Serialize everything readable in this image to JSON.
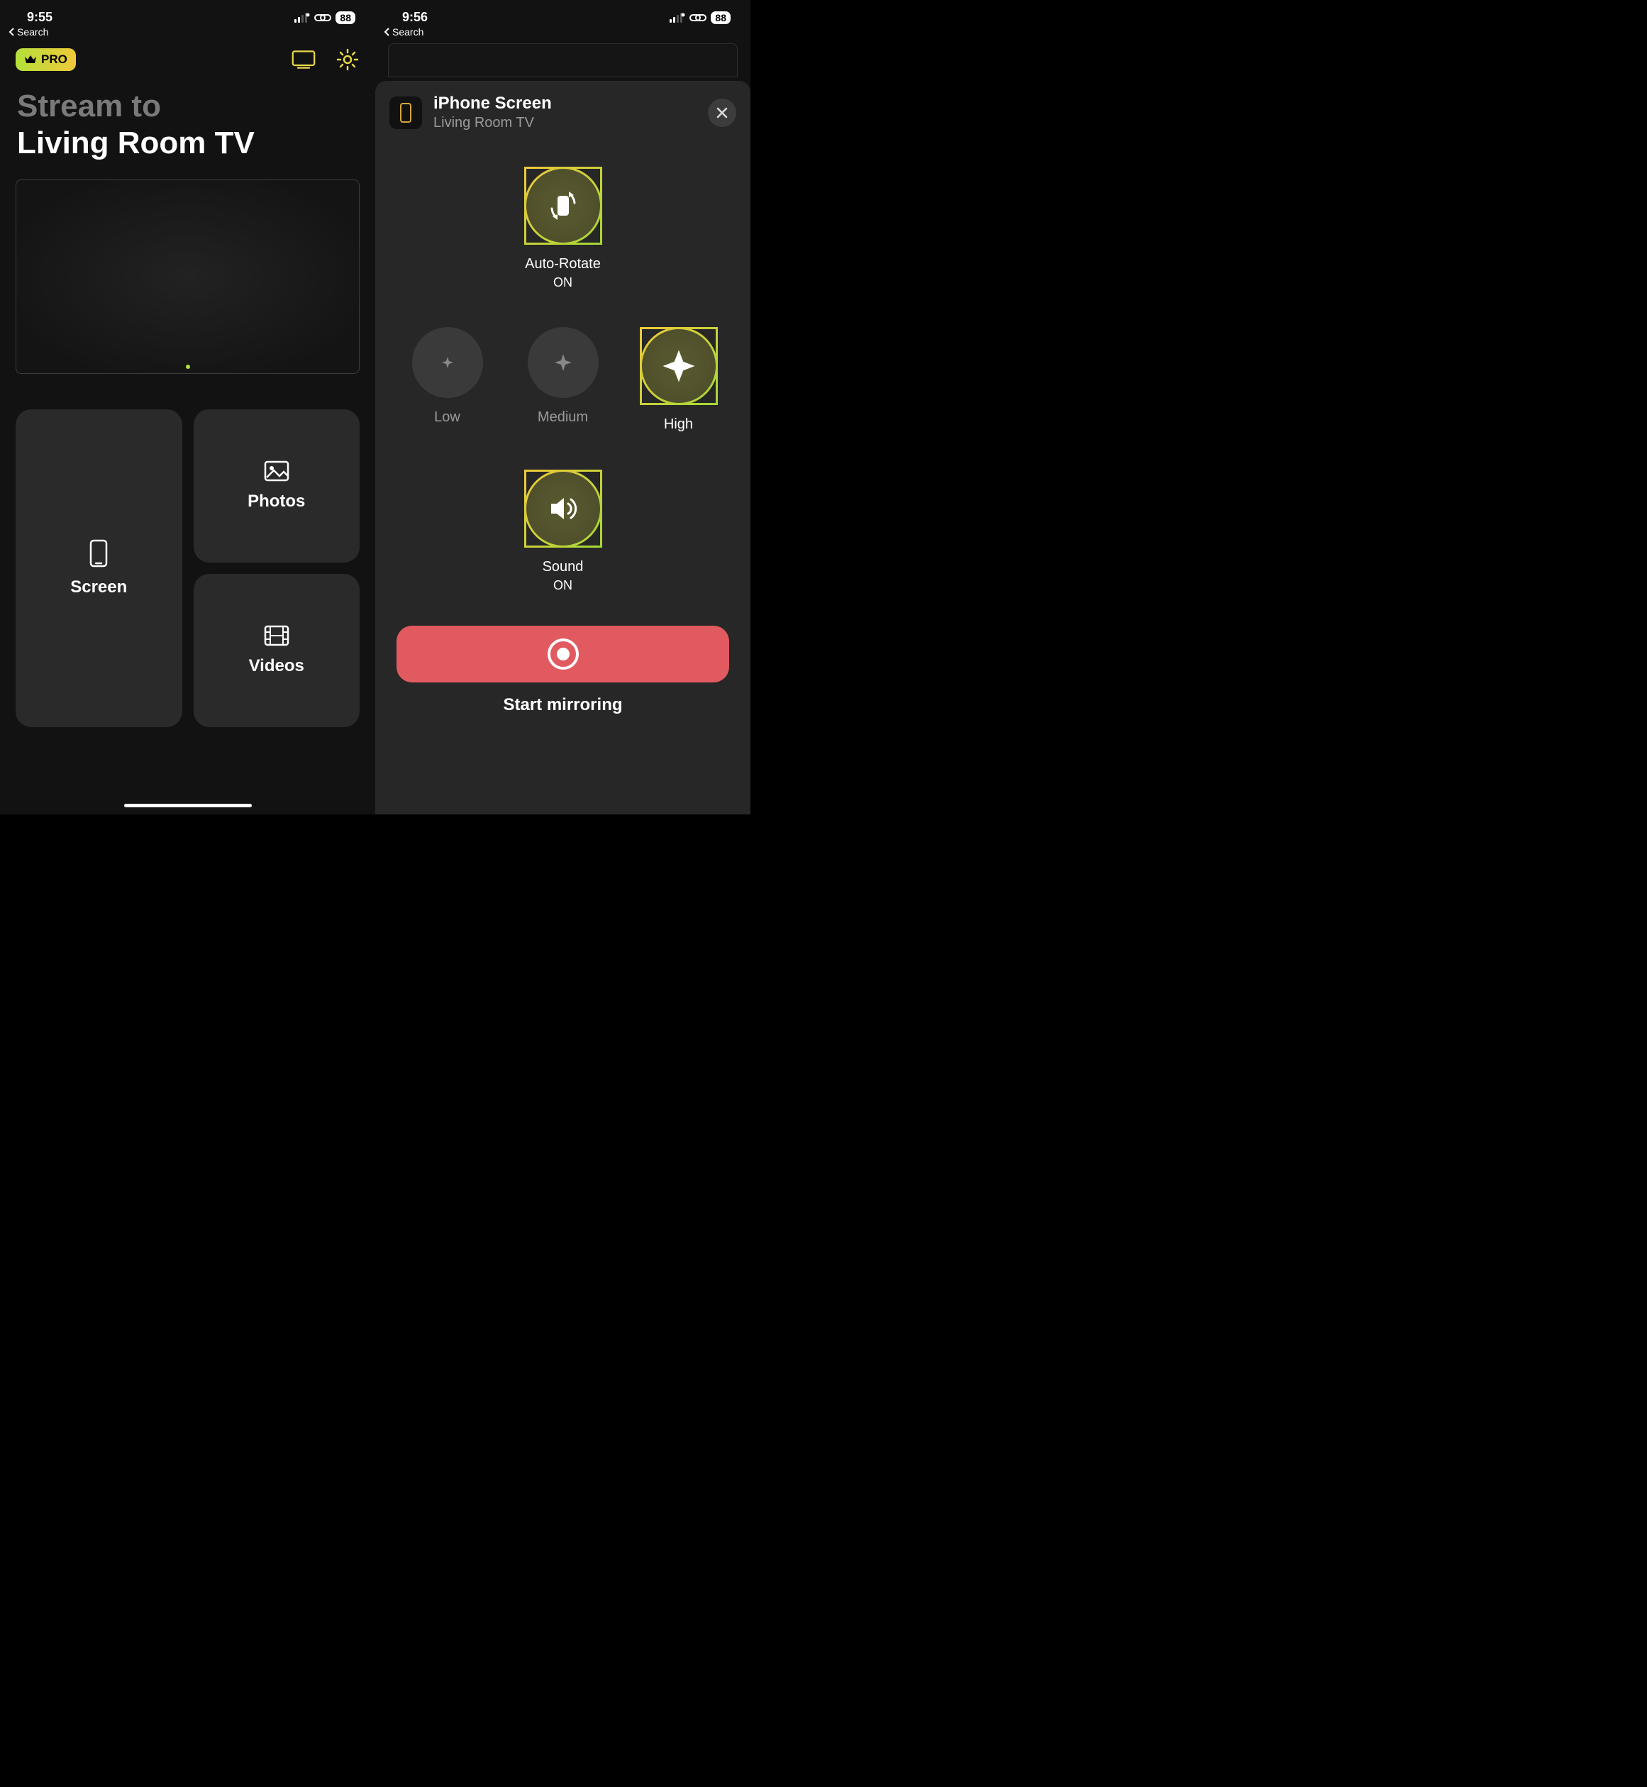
{
  "left": {
    "status": {
      "time": "9:55",
      "battery": "88",
      "back": "Search"
    },
    "pro_label": "PRO",
    "hero": {
      "sub": "Stream to",
      "main": "Living Room TV"
    },
    "tiles": {
      "screen": "Screen",
      "photos": "Photos",
      "videos": "Videos"
    }
  },
  "right": {
    "status": {
      "time": "9:56",
      "battery": "88",
      "back": "Search"
    },
    "sheet": {
      "title": "iPhone Screen",
      "subtitle": "Living Room TV",
      "autorotate": {
        "label": "Auto-Rotate",
        "state": "ON"
      },
      "quality": {
        "low": "Low",
        "medium": "Medium",
        "high": "High"
      },
      "sound": {
        "label": "Sound",
        "state": "ON"
      },
      "start": "Start mirroring"
    }
  }
}
